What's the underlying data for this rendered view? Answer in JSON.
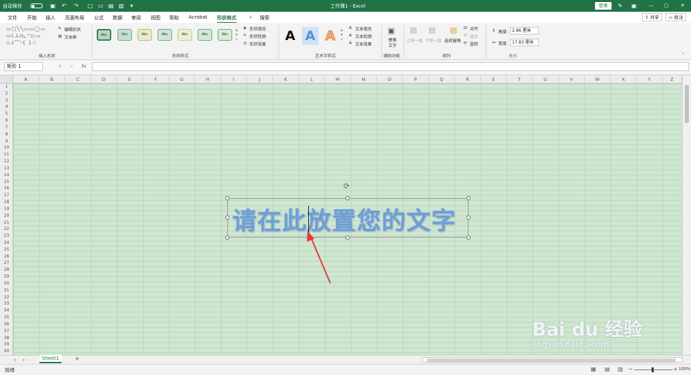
{
  "titlebar": {
    "autosave_label": "自动保存",
    "doc_title": "工作簿1 - Excel",
    "login_button": "登录",
    "minimize": "—",
    "restore": "▢",
    "close": "✕"
  },
  "tabs": {
    "file": "文件",
    "home": "开始",
    "insert": "插入",
    "page_layout": "页面布局",
    "formulas": "公式",
    "data": "数据",
    "review": "审阅",
    "view": "视图",
    "help": "帮助",
    "acrobat": "Acrobat",
    "shape_format": "形状格式",
    "search": "搜索",
    "share": "共享",
    "comments": "批注"
  },
  "ribbon": {
    "insert_shapes_group": "插入形状",
    "edit_shape": "编辑形状",
    "text_box": "文本框",
    "shape_styles_group": "形状样式",
    "style_sample": "Abc",
    "shape_fill": "形状填充",
    "shape_outline": "形状轮廓",
    "shape_effects": "形状效果",
    "wordart_group": "艺术字样式",
    "wordart_letter": "A",
    "text_fill": "文本填充",
    "text_outline": "文本轮廓",
    "text_effects": "文本效果",
    "accessibility_group": "辅助功能",
    "alt_text_line1": "替换",
    "alt_text_line2": "文字",
    "arrange_group": "排列",
    "bring_forward": "上移一层",
    "send_backward": "下移一层",
    "selection_pane": "选择窗格",
    "align": "对齐",
    "group": "组合",
    "rotate": "旋转",
    "size_group": "大小",
    "height_label": "高度:",
    "height_value": "2.86 厘米",
    "width_label": "宽度:",
    "width_value": "17.83 厘米"
  },
  "formula_bar": {
    "name_box": "矩形 1",
    "fx": "fx",
    "cancel": "✕",
    "enter": "✓"
  },
  "columns": [
    "A",
    "B",
    "C",
    "D",
    "E",
    "F",
    "G",
    "H",
    "I",
    "J",
    "K",
    "L",
    "M",
    "N",
    "O",
    "P",
    "Q",
    "R",
    "S",
    "T",
    "U",
    "V",
    "W",
    "X",
    "Y",
    "Z"
  ],
  "rows": [
    "1",
    "2",
    "3",
    "4",
    "5",
    "6",
    "7",
    "8",
    "9",
    "10",
    "11",
    "12",
    "13",
    "14",
    "15",
    "16",
    "17",
    "18",
    "19",
    "20",
    "21",
    "22",
    "23",
    "24",
    "25",
    "26",
    "27",
    "28",
    "29",
    "30",
    "31",
    "32",
    "33",
    "34",
    "35",
    "36",
    "37",
    "38",
    "39",
    "40"
  ],
  "shape": {
    "text": "请在此放置您的文字",
    "fill_color": "#6e9fd6"
  },
  "sheet": {
    "tab_name": "Sheet1",
    "add_sheet": "+"
  },
  "status": {
    "ready": "就绪",
    "zoom": "100%",
    "zoom_out": "−",
    "zoom_in": "+"
  },
  "watermark": {
    "brand": "Bai du 经验",
    "url": "jingyan.baidu.com"
  },
  "colors": {
    "excel_green": "#217346",
    "grid_bg": "#cfe6d1",
    "arrow_red": "#e53b3b"
  }
}
